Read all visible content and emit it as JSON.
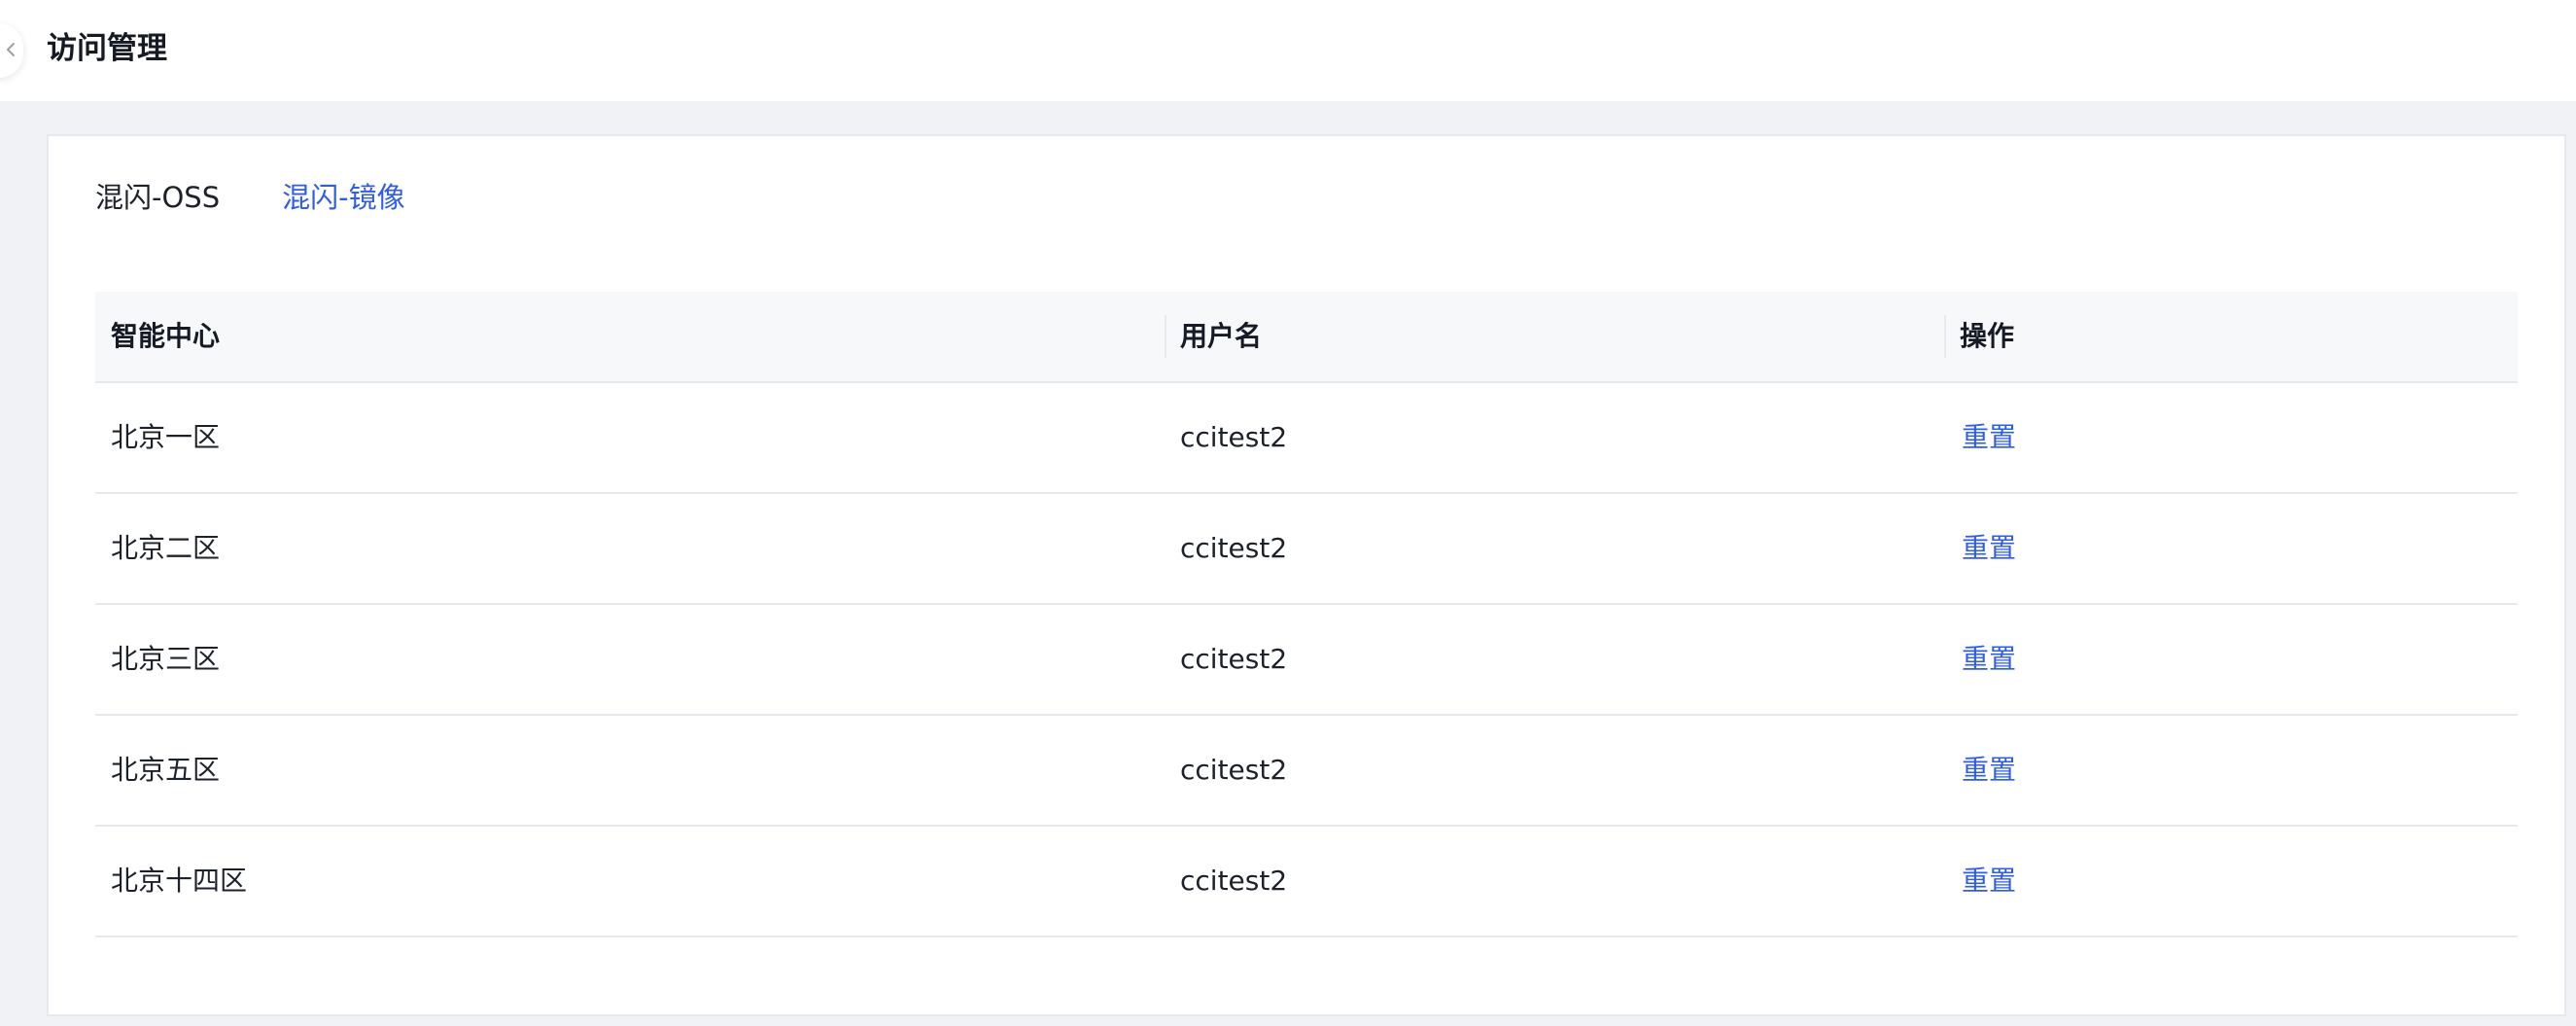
{
  "header": {
    "title": "访问管理",
    "collapse_icon": "chevron-left-icon"
  },
  "tabs": [
    {
      "label": "混闪-OSS",
      "active": false
    },
    {
      "label": "混闪-镜像",
      "active": true
    }
  ],
  "table": {
    "columns": [
      "智能中心",
      "用户名",
      "操作"
    ],
    "rows": [
      {
        "center": "北京一区",
        "username": "ccitest2",
        "action": "重置"
      },
      {
        "center": "北京二区",
        "username": "ccitest2",
        "action": "重置"
      },
      {
        "center": "北京三区",
        "username": "ccitest2",
        "action": "重置"
      },
      {
        "center": "北京五区",
        "username": "ccitest2",
        "action": "重置"
      },
      {
        "center": "北京十四区",
        "username": "ccitest2",
        "action": "重置"
      }
    ]
  },
  "colors": {
    "accent": "#2f5de8",
    "background": "#f0f2f5",
    "header_bg": "#f7f8fa",
    "border": "#e5e8ed"
  }
}
